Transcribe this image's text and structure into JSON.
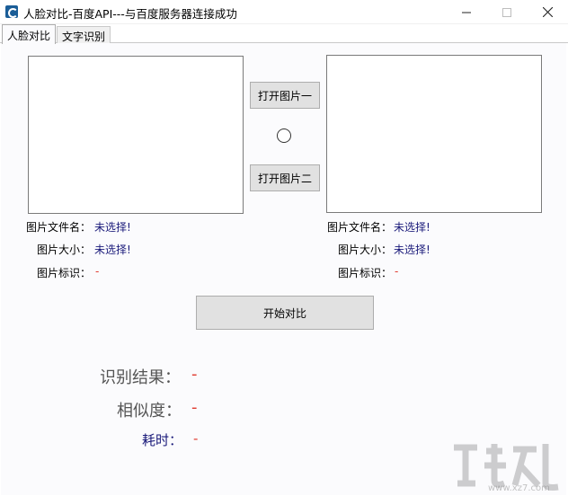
{
  "window": {
    "title": "人脸对比-百度API---与百度服务器连接成功",
    "icon": "app-icon",
    "controls": {
      "minimize": "minimize-icon",
      "maximize": "maximize-icon",
      "close": "close-icon"
    }
  },
  "tabs": [
    {
      "label": "人脸对比",
      "active": true
    },
    {
      "label": "文字识别",
      "active": false
    }
  ],
  "buttons": {
    "open1": "打开图片一",
    "open2": "打开图片二",
    "compare": "开始对比"
  },
  "left": {
    "file_name_label": "图片文件名：",
    "file_name_value": "未选择!",
    "size_label": "图片大小：",
    "size_value": "未选择!",
    "id_label": "图片标识：",
    "id_value": "-"
  },
  "right": {
    "file_name_label": "图片文件名：",
    "file_name_value": "未选择!",
    "size_label": "图片大小：",
    "size_value": "未选择!",
    "id_label": "图片标识：",
    "id_value": "-"
  },
  "results": {
    "recognition_label": "识别结果：",
    "recognition_value": "-",
    "similarity_label": "相似度：",
    "similarity_value": "-",
    "time_label": "耗时：",
    "time_value": "-"
  },
  "watermark_text": "www.xz7.com",
  "colors": {
    "value_text": "#1a1a7a",
    "dash": "#e03c31",
    "button_bg": "#e1e1e1",
    "content_bg": "#fbfbfd"
  }
}
